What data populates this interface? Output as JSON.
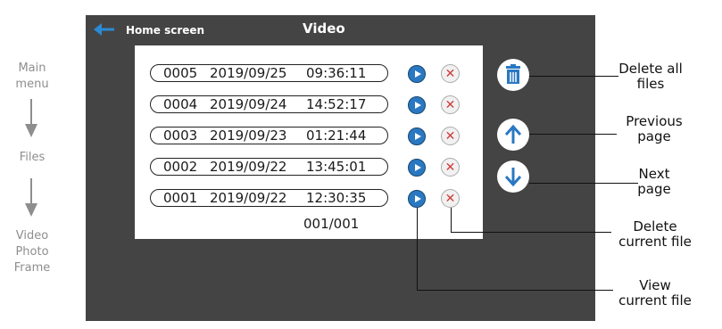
{
  "navigation": {
    "steps": [
      "Main\nmenu",
      "Files",
      "Video\nPhoto\nFrame"
    ]
  },
  "header": {
    "back_label": "Home screen",
    "title": "Video"
  },
  "files": [
    {
      "number": "0005",
      "date": "2019/09/25",
      "time": "09:36:11"
    },
    {
      "number": "0004",
      "date": "2019/09/24",
      "time": "14:52:17"
    },
    {
      "number": "0003",
      "date": "2019/09/23",
      "time": "01:21:44"
    },
    {
      "number": "0002",
      "date": "2019/09/22",
      "time": "13:45:01"
    },
    {
      "number": "0001",
      "date": "2019/09/22",
      "time": "12:30:35"
    }
  ],
  "page_counter": "001/001",
  "callouts": {
    "delete_all": "Delete all\nfiles",
    "previous": "Previous\npage",
    "next": "Next\npage",
    "delete_current": "Delete\ncurrent file",
    "view_current": "View\ncurrent file"
  },
  "colors": {
    "screen_bg": "#444444",
    "accent_blue": "#2a78c2",
    "delete_red": "#d23a3a"
  }
}
